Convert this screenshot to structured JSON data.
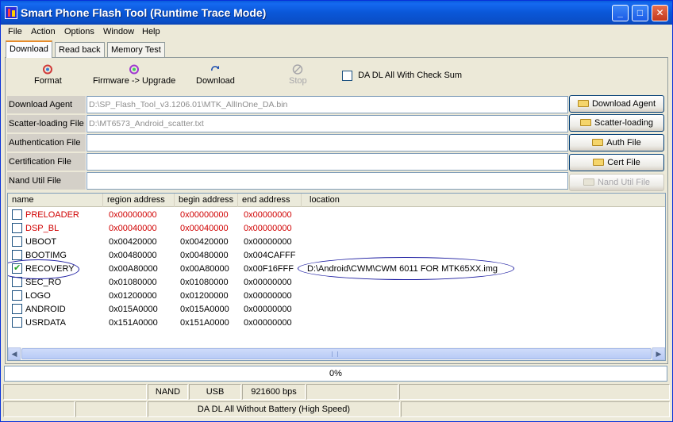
{
  "window": {
    "title": "Smart Phone Flash Tool (Runtime Trace Mode)",
    "minimize_glyph": "_",
    "maximize_glyph": "□",
    "close_glyph": "✕"
  },
  "menu": [
    "File",
    "Action",
    "Options",
    "Window",
    "Help"
  ],
  "tabs": [
    "Download",
    "Read back",
    "Memory Test"
  ],
  "toolbar": {
    "format": "Format",
    "firmware_upgrade": "Firmware -> Upgrade",
    "download": "Download",
    "stop": "Stop",
    "da_checksum": "DA DL All With Check Sum"
  },
  "fields": [
    {
      "label": "Download Agent",
      "value": "D:\\SP_Flash_Tool_v3.1206.01\\MTK_AllInOne_DA.bin",
      "button": "Download Agent"
    },
    {
      "label": "Scatter-loading File",
      "value": "D:\\MT6573_Android_scatter.txt",
      "button": "Scatter-loading"
    },
    {
      "label": "Authentication File",
      "value": "",
      "button": "Auth File"
    },
    {
      "label": "Certification File",
      "value": "",
      "button": "Cert File"
    },
    {
      "label": "Nand Util File",
      "value": "",
      "button": "Nand Util File"
    }
  ],
  "columns": [
    "name",
    "region address",
    "begin address",
    "end address",
    "location"
  ],
  "rows": [
    {
      "name": "PRELOADER",
      "region": "0x00000000",
      "begin": "0x00000000",
      "end": "0x00000000",
      "location": "",
      "checked": false,
      "red": true
    },
    {
      "name": "DSP_BL",
      "region": "0x00040000",
      "begin": "0x00040000",
      "end": "0x00000000",
      "location": "",
      "checked": false,
      "red": true
    },
    {
      "name": "UBOOT",
      "region": "0x00420000",
      "begin": "0x00420000",
      "end": "0x00000000",
      "location": "",
      "checked": false,
      "red": false
    },
    {
      "name": "BOOTIMG",
      "region": "0x00480000",
      "begin": "0x00480000",
      "end": "0x004CAFFF",
      "location": "",
      "checked": false,
      "red": false
    },
    {
      "name": "RECOVERY",
      "region": "0x00A80000",
      "begin": "0x00A80000",
      "end": "0x00F16FFF",
      "location": "D:\\Android\\CWM\\CWM 6011 FOR MTK65XX.img",
      "checked": true,
      "red": false
    },
    {
      "name": "SEC_RO",
      "region": "0x01080000",
      "begin": "0x01080000",
      "end": "0x00000000",
      "location": "",
      "checked": false,
      "red": false
    },
    {
      "name": "LOGO",
      "region": "0x01200000",
      "begin": "0x01200000",
      "end": "0x00000000",
      "location": "",
      "checked": false,
      "red": false
    },
    {
      "name": "ANDROID",
      "region": "0x015A0000",
      "begin": "0x015A0000",
      "end": "0x00000000",
      "location": "",
      "checked": false,
      "red": false
    },
    {
      "name": "USRDATA",
      "region": "0x151A0000",
      "begin": "0x151A0000",
      "end": "0x00000000",
      "location": "",
      "checked": false,
      "red": false
    }
  ],
  "progress": {
    "text": "0%",
    "fraction": 0
  },
  "status": {
    "nand": "NAND",
    "usb": "USB",
    "baud": "921600 bps",
    "mode": "DA DL All Without Battery (High Speed)"
  },
  "colors": {
    "titlebar": "#0a57d8",
    "error_text": "#d00000",
    "selection_tab": "#e68b2c"
  }
}
